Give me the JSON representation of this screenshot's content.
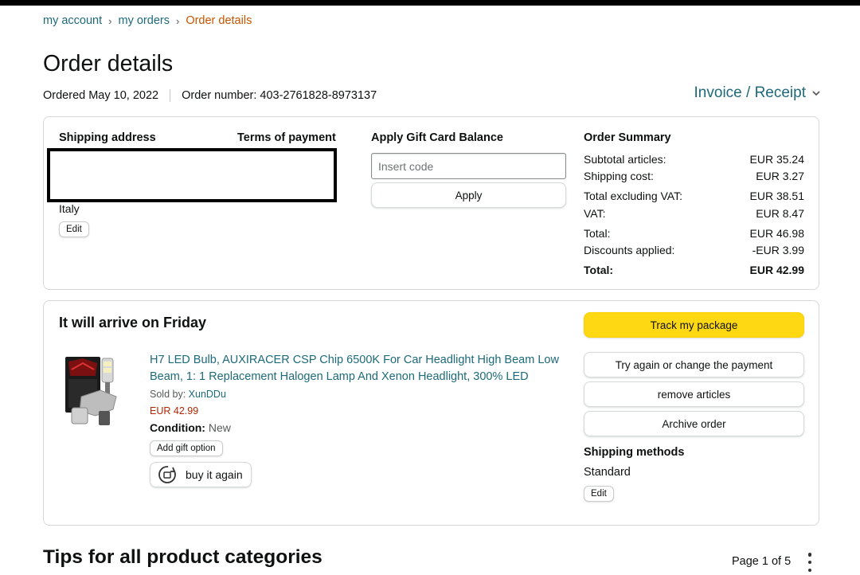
{
  "breadcrumb": {
    "items": [
      "my account",
      "my orders"
    ],
    "current": "Order details",
    "separator": "›"
  },
  "page_title": "Order details",
  "order_meta": {
    "ordered": "Ordered May 10, 2022",
    "order_number": "Order number: 403-2761828-8973137"
  },
  "invoice": {
    "label": "Invoice / Receipt"
  },
  "top_card": {
    "shipping_address_heading": "Shipping address",
    "terms_heading": "Terms of payment",
    "country": "Italy",
    "edit_label": "Edit",
    "gift_card": {
      "heading": "Apply Gift Card Balance",
      "placeholder": "Insert code",
      "apply_label": "Apply"
    },
    "summary": {
      "heading": "Order Summary",
      "subtotal_label": "Subtotal articles:",
      "subtotal_value": "EUR 35.24",
      "shipping_label": "Shipping cost:",
      "shipping_value": "EUR 3.27",
      "excl_vat_label": "Total excluding VAT:",
      "excl_vat_value": "EUR 38.51",
      "vat_label": "VAT:",
      "vat_value": "EUR 8.47",
      "total_label": "Total:",
      "total_value": "EUR 46.98",
      "discounts_label": "Discounts applied:",
      "discounts_value": "-EUR 3.99",
      "grand_total_label": "Total:",
      "grand_total_value": "EUR 42.99"
    }
  },
  "shipment": {
    "arrival": "It will arrive on Friday",
    "product": {
      "title": "H7 LED Bulb, AUXIRACER CSP Chip 6500K For Car Headlight High Beam Low Beam, 1: 1 Replacement Halogen Lamp And Xenon Headlight, 300% LED",
      "sold_by_label": "Sold by:",
      "seller": "XunDDu",
      "price": "EUR 42.99",
      "condition_label": "Condition:",
      "condition_value": "New",
      "add_gift_label": "Add gift option",
      "buy_again_label": "buy it again"
    },
    "actions": {
      "track": "Track my package",
      "retry_payment": "Try again or change the payment",
      "remove": "remove articles",
      "archive": "Archive order"
    },
    "shipping_methods_heading": "Shipping methods",
    "shipping_method": "Standard",
    "edit_label": "Edit"
  },
  "tips": {
    "heading": "Tips for all product categories",
    "page_indicator": "Page 1 of 5"
  },
  "colors": {
    "link": "#1d6a78",
    "breadcrumb_current": "#c45500",
    "price": "#b12704",
    "primary_button": "#ffd814",
    "border": "#d5d9d9"
  },
  "icons": {
    "invoice_chevron": "chevron-down-icon",
    "buy_again": "reorder-icon",
    "more": "more-vertical-icon"
  }
}
